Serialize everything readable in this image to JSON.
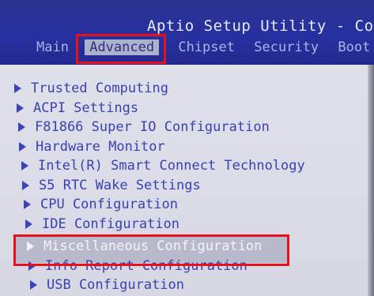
{
  "header": {
    "title": "Aptio Setup Utility - Copy",
    "tabs": [
      {
        "label": "Main",
        "active": false
      },
      {
        "label": "Advanced",
        "active": true
      },
      {
        "label": "Chipset",
        "active": false
      },
      {
        "label": "Security",
        "active": false
      },
      {
        "label": "Boot",
        "active": false
      }
    ]
  },
  "menu": {
    "items": [
      {
        "label": "Trusted Computing"
      },
      {
        "label": "ACPI Settings"
      },
      {
        "label": "F81866 Super IO Configuration"
      },
      {
        "label": "Hardware Monitor"
      },
      {
        "label": "Intel(R) Smart Connect Technology"
      },
      {
        "label": "S5 RTC Wake Settings"
      },
      {
        "label": "CPU Configuration"
      },
      {
        "label": "IDE Configuration"
      },
      {
        "label": "Miscellaneous Configuration",
        "selected": true
      },
      {
        "label": "Info Report Configuration"
      },
      {
        "label": "USB Configuration"
      }
    ]
  },
  "colors": {
    "header_bg": "#2730a0",
    "menu_text": "#3842b0",
    "highlight_box": "#e6111b"
  }
}
